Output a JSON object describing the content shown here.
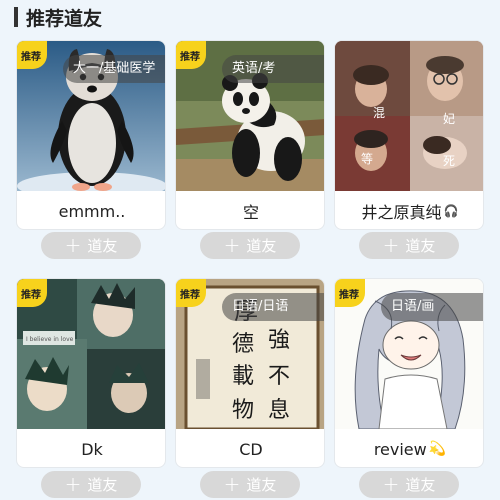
{
  "section": {
    "title": "推荐道友"
  },
  "add_label": "道友",
  "plus_glyph": "+",
  "cards": [
    {
      "badge": "推荐",
      "tag": "大一/基础医学",
      "name": "emmm..",
      "emoji": ""
    },
    {
      "badge": "推荐",
      "tag": "英语/考",
      "name": "空",
      "emoji": ""
    },
    {
      "badge": "",
      "tag": "",
      "name": "井之原真纯",
      "emoji": "🎧",
      "captions": [
        "混",
        "妃",
        "等",
        "死"
      ]
    },
    {
      "badge": "推荐",
      "tag": "",
      "name": "Dk",
      "emoji": "",
      "poster_text": "I believe in love"
    },
    {
      "badge": "推荐",
      "tag": "日语/日语",
      "name": "CD",
      "emoji": "",
      "calligraphy": [
        "厚",
        "強",
        "德",
        "不",
        "載",
        "息",
        "物"
      ]
    },
    {
      "badge": "推荐",
      "tag": "日语/画",
      "name": "review",
      "emoji": "💫"
    }
  ],
  "colors": {
    "badge": "#f7d21c",
    "add_button": "#d8d8d8",
    "background": "#eef5fb"
  }
}
